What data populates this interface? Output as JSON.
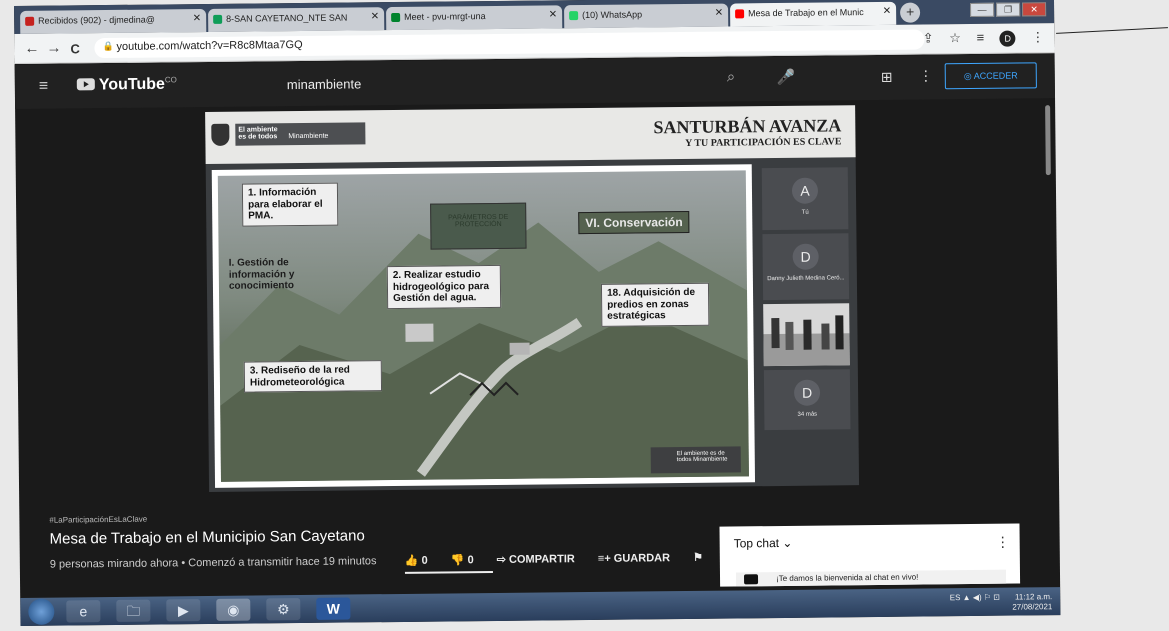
{
  "browser": {
    "tabs": [
      {
        "label": "Recibidos (902) - djmedina@",
        "icon_color": "#c5221f"
      },
      {
        "label": "8-SAN CAYETANO_NTE SAN",
        "icon_color": "#0f9d58"
      },
      {
        "label": "Meet - pvu-mrgt-una",
        "icon_color": "#00832d"
      },
      {
        "label": "(10) WhatsApp",
        "icon_color": "#25d366"
      },
      {
        "label": "Mesa de Trabajo en el Munic",
        "icon_color": "#ff0000"
      }
    ],
    "new_tab_glyph": "+",
    "window_buttons": [
      "—",
      "❐",
      "✕"
    ],
    "nav": {
      "back": "←",
      "forward": "→",
      "reload": "C"
    },
    "url": "youtube.com/watch?v=R8c8Mtaa7GQ",
    "lock_glyph": "🔒",
    "extras": [
      "⇪",
      "☆",
      "≡"
    ],
    "profile_initial": "D"
  },
  "youtube": {
    "menu_icon": "≡",
    "logo_text": "YouTube",
    "logo_sup": "CO",
    "search_value": "minambiente",
    "search_glyph": "⌕",
    "mic_glyph": "🎤",
    "apps_glyph": "⊞",
    "more_glyph": "⋮",
    "sign_in_label": "ACCEDER"
  },
  "slide_header": {
    "ministry_a": "El ambiente es de todos",
    "ministry_b": "Minambiente",
    "title": "SANTURBÁN AVANZA",
    "subtitle": "Y TU PARTICIPACIÓN ES CLAVE"
  },
  "slide": {
    "box1": "1. Información para elaborar el PMA.",
    "box_gestion": "I. Gestión de información y conocimiento",
    "box2": "2. Realizar estudio hidrogeológico para Gestión del agua.",
    "box3": "3. Rediseño de la red Hidrometeorológica",
    "box18": "18. Adquisición de predios en zonas estratégicas",
    "conservacion": "VI. Conservación",
    "park_box": "PARÁMETROS DE PROTECCIÓN",
    "logo_a": "El ambiente es de todos",
    "logo_b": "Minambiente"
  },
  "participants": [
    {
      "initial": "A",
      "name": "Tú"
    },
    {
      "initial": "D",
      "name": "Danny Julieth Medina Ceró..."
    },
    {
      "initial": "",
      "name": ""
    },
    {
      "initial": "D",
      "name": "34 más"
    }
  ],
  "video_info": {
    "hashtag": "#LaParticipaciónEsLaClave",
    "title": "Mesa de Trabajo en el Municipio San Cayetano",
    "meta": "9 personas mirando ahora • Comenzó a transmitir hace 19 minutos",
    "likes": "0",
    "dislikes": "0",
    "share_label": "COMPARTIR",
    "save_label": "GUARDAR"
  },
  "chat": {
    "title": "Top chat ⌄",
    "more": "⋮",
    "welcome": "¡Te damos la bienvenida al chat en vivo!"
  },
  "taskbar": {
    "apps": [
      "e",
      "🗀",
      "▶",
      "◉",
      "⚙",
      "W"
    ],
    "lang": "ES",
    "time": "11:12 a.m.",
    "date": "27/08/2021"
  }
}
